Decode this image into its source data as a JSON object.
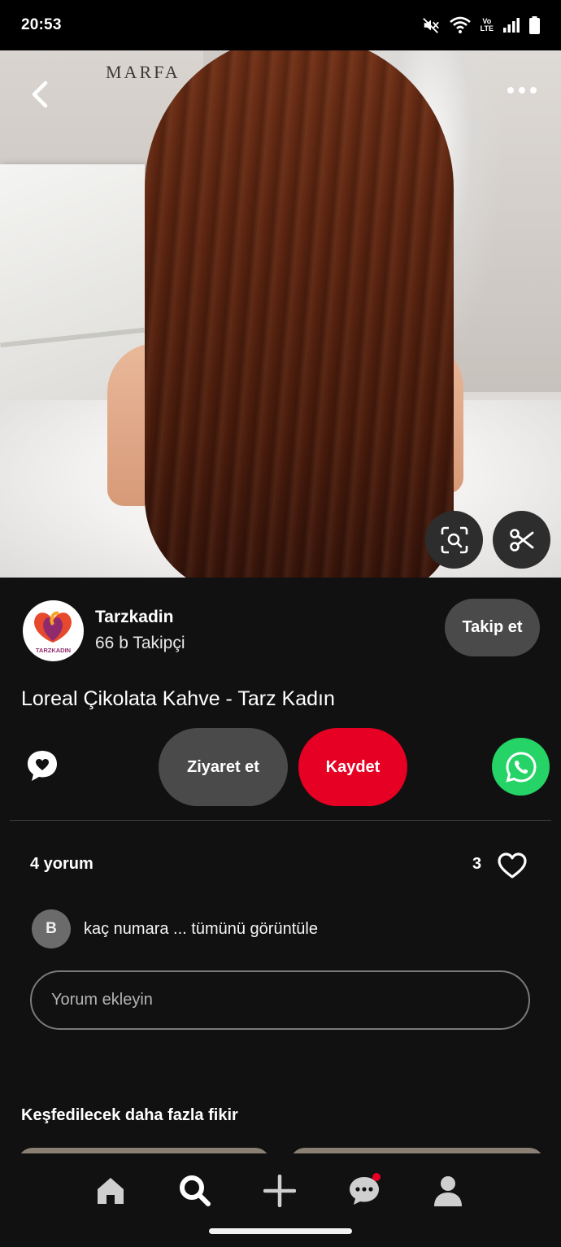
{
  "status_bar": {
    "time": "20:53",
    "icons": [
      "mute-icon",
      "wifi-icon",
      "volte-icon",
      "signal-icon",
      "battery-icon"
    ],
    "volte_label_top": "Vo",
    "volte_label_bottom": "LTE"
  },
  "hero": {
    "sign_text": "MARFA",
    "back_icon": "chevron-left-icon",
    "more_icon": "more-dots-icon",
    "lens_icon": "visual-search-icon",
    "cut_icon": "scissors-icon"
  },
  "profile": {
    "name": "Tarzkadin",
    "followers": "66 b Takipçi",
    "follow_label": "Takip et",
    "avatar_text": "TARZKADIN"
  },
  "pin": {
    "title": "Loreal Çikolata Kahve - Tarz Kadın"
  },
  "actions": {
    "share_icon": "share-icon",
    "visit_label": "Ziyaret et",
    "save_label": "Kaydet",
    "whatsapp_icon": "whatsapp-icon"
  },
  "comments": {
    "count_label": "4 yorum",
    "like_count": "3",
    "preview_avatar": "B",
    "preview_text": "kaç numara ... tümünü görüntüle",
    "input_placeholder": "Yorum ekleyin"
  },
  "more_ideas": {
    "title": "Keşfedilecek daha fazla fikir"
  },
  "bottom_nav": {
    "items": [
      "home-icon",
      "search-icon",
      "create-icon",
      "messages-icon",
      "profile-icon"
    ],
    "active": "search-icon"
  },
  "colors": {
    "background": "#111111",
    "save_red": "#e60023",
    "button_gray": "#4a4a4a",
    "whatsapp_green": "#25d366"
  }
}
